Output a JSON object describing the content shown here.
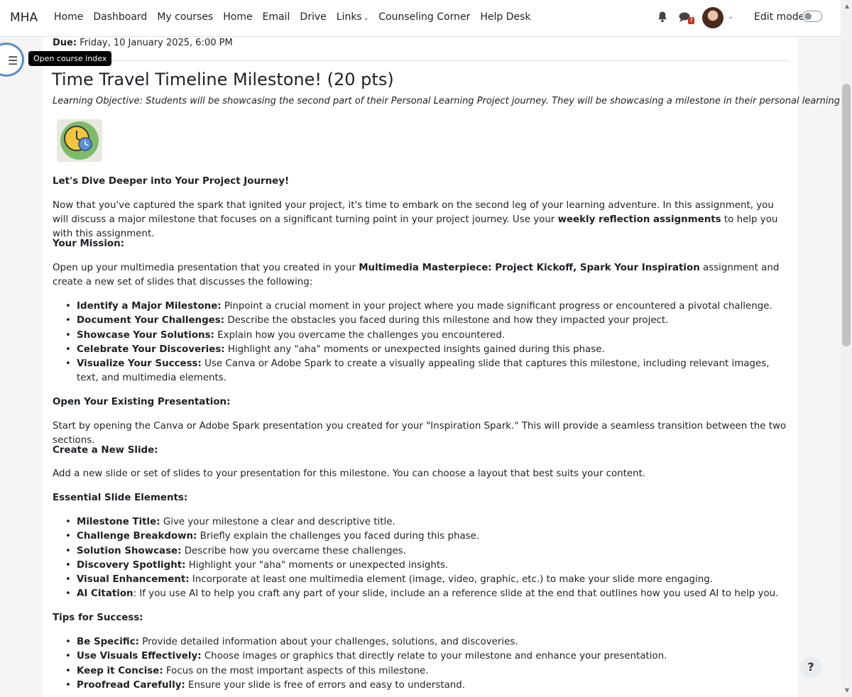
{
  "nav": {
    "brand": "MHA",
    "links": [
      "Home",
      "Dashboard",
      "My courses",
      "Home",
      "Email",
      "Drive",
      "Links",
      "Counseling Corner",
      "Help Desk"
    ],
    "message_count": "7",
    "edit_mode_label": "Edit mode"
  },
  "drawer": {
    "tooltip": "Open course index"
  },
  "assignment": {
    "due_label": "Due:",
    "due_value": "Friday, 10 January 2025, 6:00 PM",
    "title": "Time Travel Timeline Milestone! (20 pts)",
    "objective": "Learning Objective: Students will be showcasing the second part of their Personal Learning Project journey. They will be showcasing a milestone in their personal learning journey."
  },
  "body": {
    "dive_heading": "Let's Dive Deeper into Your Project Journey!",
    "intro_part1": "Now that you've captured the spark that ignited your project, it's time to embark on the second leg of your learning adventure.  In this assignment, you will discuss a major milestone that focuses on a significant turning point in your project journey. Use your ",
    "intro_bold": "weekly reflection assignments",
    "intro_part2": " to help you with this assignment.",
    "mission_heading": "Your Mission:",
    "mission_part1": "Open up your multimedia presentation that you created in your ",
    "mission_bold": "Multimedia Masterpiece: Project Kickoff, Spark Your Inspiration",
    "mission_part2": " assignment and create a new set of slides that discusses the following:",
    "mission_items": [
      {
        "label": "Identify a Major Milestone:",
        "text": " Pinpoint a crucial moment in your project where you made significant progress or encountered a pivotal challenge."
      },
      {
        "label": "Document Your Challenges:",
        "text": " Describe the obstacles you faced during this milestone and how they impacted your project."
      },
      {
        "label": "Showcase Your Solutions:",
        "text": " Explain how you overcame the challenges you encountered."
      },
      {
        "label": "Celebrate Your Discoveries:",
        "text": " Highlight any \"aha\" moments or unexpected insights gained during this phase."
      },
      {
        "label": "Visualize Your Success:",
        "text": " Use Canva or Adobe Spark to create a visually appealing slide that captures this milestone, including relevant images, text, and multimedia elements."
      }
    ],
    "open_heading": "Open Your Existing Presentation:",
    "open_text": "Start by opening the Canva or Adobe Spark presentation you created for your \"Inspiration Spark.\" This will provide a seamless transition between the two sections.",
    "create_heading": "Create a New Slide:",
    "create_text": "Add a new slide or set of slides to your presentation for this milestone. You can choose a layout that best suits your content.",
    "elements_heading": "Essential Slide Elements:",
    "elements_items": [
      {
        "label": "Milestone Title:",
        "text": " Give your milestone a clear and descriptive title."
      },
      {
        "label": "Challenge Breakdown:",
        "text": " Briefly explain the challenges you faced during this phase."
      },
      {
        "label": "Solution Showcase:",
        "text": " Describe how you overcame these challenges."
      },
      {
        "label": "Discovery Spotlight:",
        "text": " Highlight your \"aha\" moments or unexpected insights."
      },
      {
        "label": "Visual Enhancement:",
        "text": " Incorporate at least one multimedia element (image, video, graphic, etc.) to make your slide more engaging."
      },
      {
        "label": "AI Citation",
        "text": ": If you use AI to help you craft any part of your slide, include an a reference slide at the end that outlines how you used AI to help you."
      }
    ],
    "tips_heading": "Tips for Success:",
    "tips_items": [
      {
        "label": "Be Specific:",
        "text": " Provide detailed information about your challenges, solutions, and discoveries."
      },
      {
        "label": "Use Visuals Effectively:",
        "text": " Choose images or graphics that directly relate to your milestone and enhance your presentation."
      },
      {
        "label": "Keep it Concise:",
        "text": " Focus on the most important aspects of this milestone."
      },
      {
        "label": "Proofread Carefully:",
        "text": " Ensure your slide is free of errors and easy to understand."
      }
    ]
  },
  "help_label": "?"
}
